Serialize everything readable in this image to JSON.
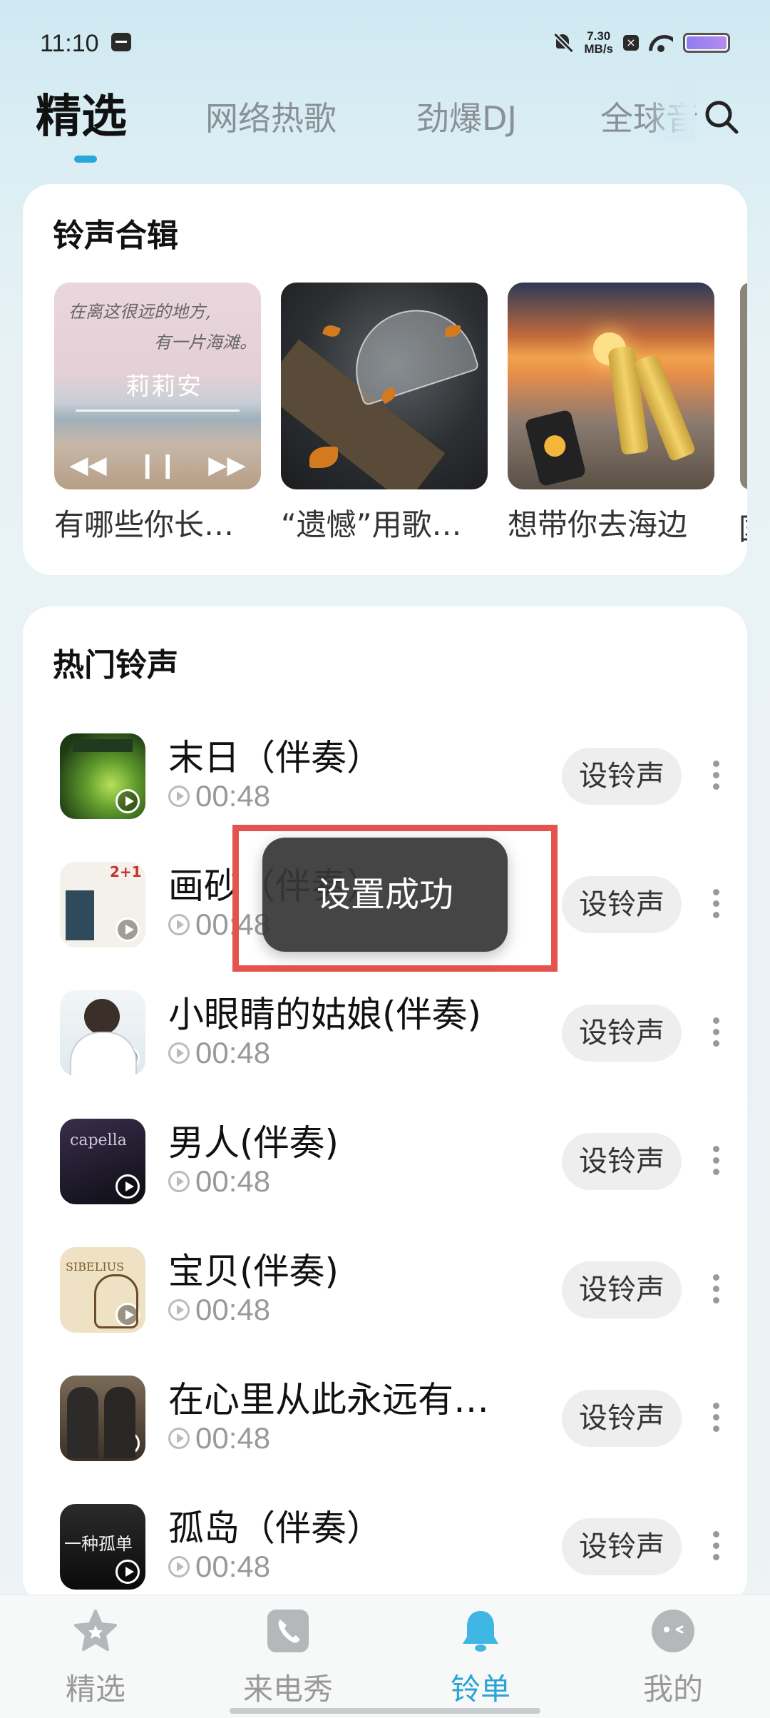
{
  "status": {
    "time": "11:10",
    "net_speed_value": "7.30",
    "net_speed_unit": "MB/s",
    "x_icon": "x-box-icon"
  },
  "tabs": [
    {
      "label": "精选",
      "active": true
    },
    {
      "label": "网络热歌",
      "active": false
    },
    {
      "label": "劲爆DJ",
      "active": false
    },
    {
      "label": "全球音",
      "active": false
    }
  ],
  "collection": {
    "title": "铃声合辑",
    "albums": [
      {
        "name": "有哪些你长…",
        "cover_text_1": "在离这很远的地方,",
        "cover_text_2": "有一片海滩。",
        "cover_mark": "莉莉安"
      },
      {
        "name": "“遗憾”用歌…"
      },
      {
        "name": "想带你去海边"
      }
    ],
    "peek_text": "国"
  },
  "hot": {
    "title": "热门铃声",
    "set_label": "设铃声",
    "songs": [
      {
        "title": "末日（伴奏）",
        "duration": "00:48"
      },
      {
        "title": "画砂（伴奏）",
        "duration": "00:48"
      },
      {
        "title": "小眼睛的姑娘(伴奏)",
        "duration": "00:48"
      },
      {
        "title": "男人(伴奏)",
        "duration": "00:48"
      },
      {
        "title": "宝贝(伴奏)",
        "duration": "00:48"
      },
      {
        "title": "在心里从此永远有…",
        "duration": "00:48"
      },
      {
        "title": "孤岛（伴奏）",
        "duration": "00:48"
      }
    ]
  },
  "toast": {
    "message": "设置成功",
    "highlight_color": "#e5534f"
  },
  "nav": [
    {
      "label": "精选",
      "icon": "star-icon",
      "active": false
    },
    {
      "label": "来电秀",
      "icon": "phone-icon",
      "active": false
    },
    {
      "label": "铃单",
      "icon": "bell-icon",
      "active": true
    },
    {
      "label": "我的",
      "icon": "profile-icon",
      "active": false
    }
  ],
  "colors": {
    "accent": "#2aa4d6",
    "inactive": "#999999"
  }
}
